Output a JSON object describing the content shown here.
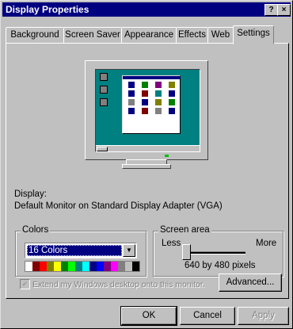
{
  "window": {
    "title": "Display Properties",
    "help_button": "?",
    "close_button": "×"
  },
  "tabs": [
    {
      "label": "Background"
    },
    {
      "label": "Screen Saver"
    },
    {
      "label": "Appearance"
    },
    {
      "label": "Effects"
    },
    {
      "label": "Web"
    },
    {
      "label": "Settings",
      "active": true
    }
  ],
  "display": {
    "label": "Display:",
    "value": "Default Monitor on Standard Display Adapter (VGA)"
  },
  "colors": {
    "group_label": "Colors",
    "selected": "16 Colors",
    "palette": [
      "#ffffff",
      "#800000",
      "#ff0000",
      "#808000",
      "#ffff00",
      "#008000",
      "#00ff00",
      "#008080",
      "#00ffff",
      "#000080",
      "#0000ff",
      "#800080",
      "#ff00ff",
      "#808080",
      "#c0c0c0",
      "#000000"
    ]
  },
  "screen_area": {
    "group_label": "Screen area",
    "less_label": "Less",
    "more_label": "More",
    "resolution": "640 by 480 pixels",
    "slider_fraction": 0.0
  },
  "extend_desktop": {
    "label": "Extend my Windows desktop onto this monitor.",
    "checked": true,
    "disabled": true
  },
  "advanced_button": "Advanced...",
  "footer": {
    "ok": "OK",
    "cancel": "Cancel",
    "apply": "Apply"
  }
}
